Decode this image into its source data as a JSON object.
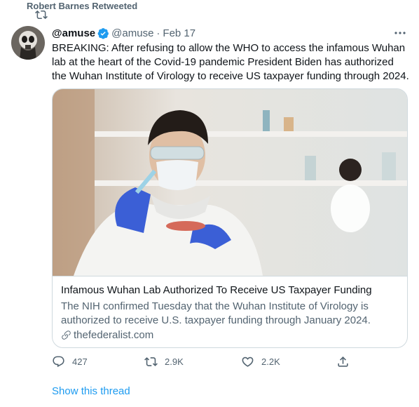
{
  "retweet": {
    "label": "Robert Barnes Retweeted"
  },
  "tweet": {
    "display_name": "@amuse",
    "handle": "@amuse",
    "separator": "·",
    "date": "Feb 17",
    "text": "BREAKING: After refusing to allow the WHO to access the infamous Wuhan lab at the heart of the Covid-19 pandemic President Biden has authorized the Wuhan Institute of Virology to receive US taxpayer funding through 2024."
  },
  "card": {
    "title": "Infamous Wuhan Lab Authorized To Receive US Taxpayer Funding",
    "description": "The NIH confirmed Tuesday that the Wuhan Institute of Virology is authorized to receive U.S. taxpayer funding through January 2024.",
    "domain": "thefederalist.com"
  },
  "actions": {
    "replies": "427",
    "retweets": "2.9K",
    "likes": "2.2K"
  },
  "show_thread": "Show this thread",
  "colors": {
    "accent": "#1d9bf0",
    "muted": "#536471",
    "text": "#0f1419",
    "border": "#cfd9de"
  },
  "icons": [
    "retweet-icon",
    "verified-badge-icon",
    "more-icon",
    "link-icon",
    "reply-icon",
    "retweet-action-icon",
    "like-icon",
    "share-icon"
  ]
}
